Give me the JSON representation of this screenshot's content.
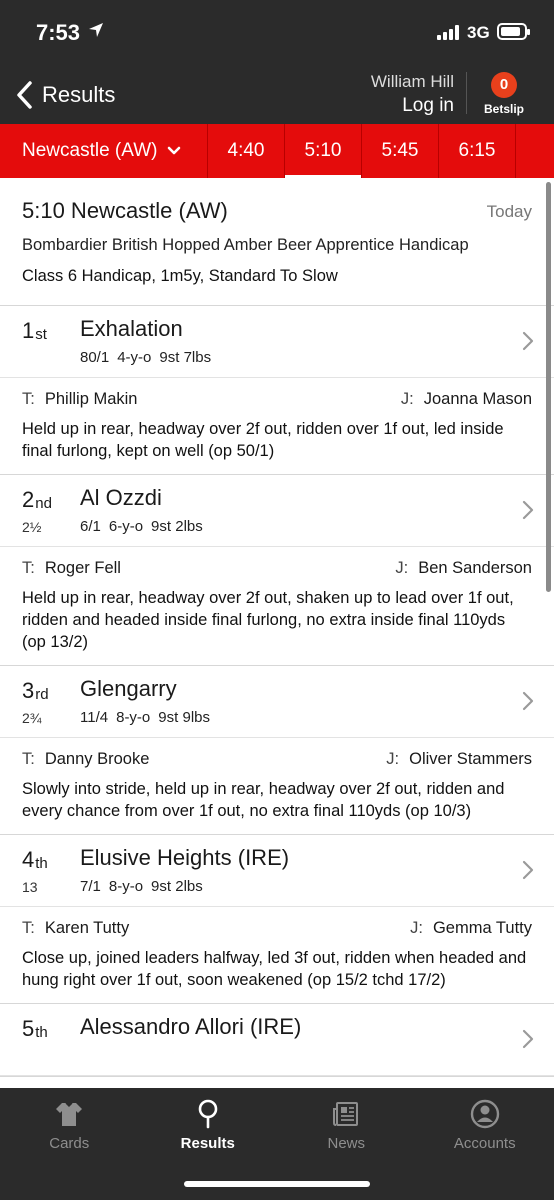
{
  "status_bar": {
    "time": "7:53",
    "network": "3G"
  },
  "nav": {
    "back_label": "Results",
    "brand": "William Hill",
    "login": "Log in",
    "betslip_count": "0",
    "betslip_label": "Betslip"
  },
  "tabs": {
    "course": "Newcastle (AW)",
    "times": [
      "4:40",
      "5:10",
      "5:45",
      "6:15"
    ],
    "active": "5:10"
  },
  "race": {
    "title": "5:10 Newcastle (AW)",
    "day": "Today",
    "name": "Bombardier British Hopped Amber Beer Apprentice Handicap",
    "class_info": "Class 6 Handicap, 1m5y, Standard To Slow"
  },
  "labels": {
    "trainer_prefix": "T:",
    "jockey_prefix": "J:",
    "yo": "-y-o",
    "st": "st",
    "lbs": "lbs"
  },
  "runners": [
    {
      "pos_num": "1",
      "pos_suffix": "st",
      "distance": "",
      "horse": "Exhalation",
      "odds": "80/1",
      "age": "4",
      "stones": "9",
      "pounds": "7",
      "trainer": "Phillip Makin",
      "jockey": "Joanna Mason",
      "comment": "Held up in rear, headway over 2f out, ridden over 1f out, led inside final furlong, kept on well (op 50/1)"
    },
    {
      "pos_num": "2",
      "pos_suffix": "nd",
      "distance": "2½",
      "horse": "Al Ozzdi",
      "odds": "6/1",
      "age": "6",
      "stones": "9",
      "pounds": "2",
      "trainer": "Roger Fell",
      "jockey": "Ben Sanderson",
      "comment": "Held up in rear, headway over 2f out, shaken up to lead over 1f out, ridden and headed inside final furlong, no extra inside final 110yds (op 13/2)"
    },
    {
      "pos_num": "3",
      "pos_suffix": "rd",
      "distance": "2¾",
      "horse": "Glengarry",
      "odds": "11/4",
      "age": "8",
      "stones": "9",
      "pounds": "9",
      "trainer": "Danny Brooke",
      "jockey": "Oliver Stammers",
      "comment": "Slowly into stride, held up in rear, headway over 2f out, ridden and every chance from over 1f out, no extra final 110yds (op 10/3)"
    },
    {
      "pos_num": "4",
      "pos_suffix": "th",
      "distance": "13",
      "horse": "Elusive Heights (IRE)",
      "odds": "7/1",
      "age": "8",
      "stones": "9",
      "pounds": "2",
      "trainer": "Karen Tutty",
      "jockey": "Gemma Tutty",
      "comment": "Close up, joined leaders halfway, led 3f out, ridden when headed and hung right over 1f out, soon weakened (op 15/2 tchd 17/2)"
    },
    {
      "pos_num": "5",
      "pos_suffix": "th",
      "distance": "",
      "horse": "Alessandro Allori (IRE)"
    }
  ],
  "bottom_nav": {
    "items": [
      "Cards",
      "Results",
      "News",
      "Accounts"
    ],
    "active": "Results"
  }
}
